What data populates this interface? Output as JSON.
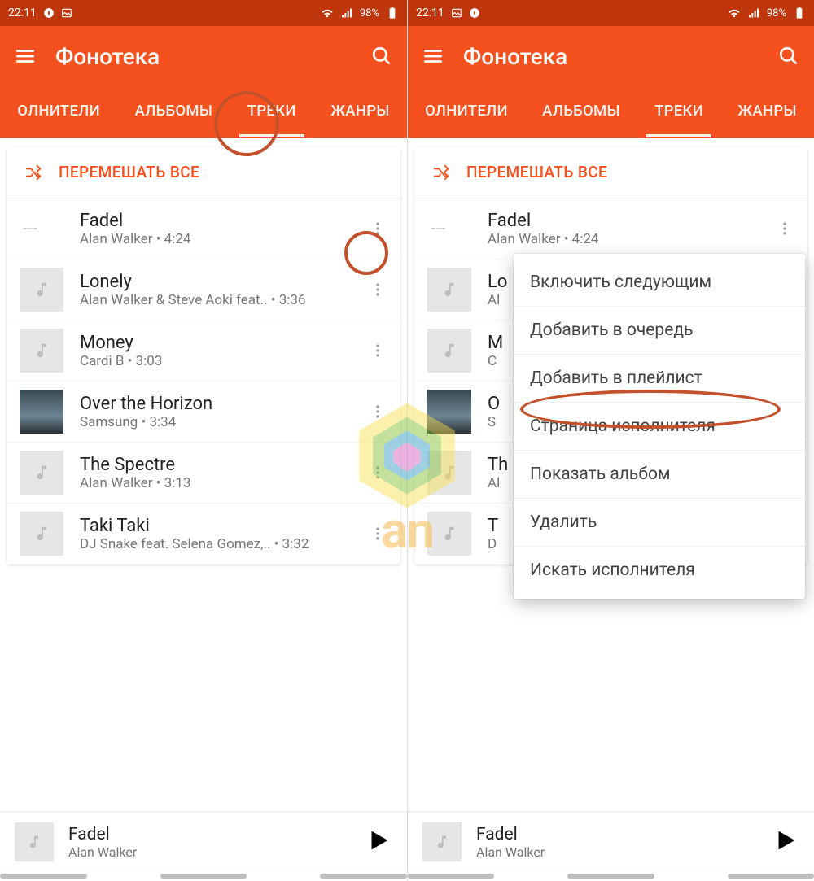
{
  "status": {
    "time": "22:11",
    "battery_pct": "98%"
  },
  "appbar": {
    "title": "Фонотека"
  },
  "tabs": {
    "items": [
      "ОЛНИТЕЛИ",
      "АЛЬБОМЫ",
      "ТРЕКИ",
      "ЖАНРЫ"
    ],
    "active_index": 2
  },
  "shuffle_label": "ПЕРЕМЕШАТЬ ВСЕ",
  "tracks": [
    {
      "title": "Fadel",
      "artist": "Alan Walker",
      "duration": "4:24",
      "art": "dash"
    },
    {
      "title": "Lonely",
      "artist": "Alan Walker & Steve Aoki feat..",
      "duration": "3:36",
      "art": "note"
    },
    {
      "title": "Money",
      "artist": "Cardi B",
      "duration": "3:03",
      "art": "note"
    },
    {
      "title": "Over the Horizon",
      "artist": "Samsung",
      "duration": "3:34",
      "art": "scene"
    },
    {
      "title": "The Spectre",
      "artist": "Alan Walker",
      "duration": "3:13",
      "art": "note"
    },
    {
      "title": "Taki Taki",
      "artist": "DJ Snake feat. Selena Gomez,..",
      "duration": "3:32",
      "art": "note"
    }
  ],
  "tracks_truncated": [
    {
      "title": "Fadel",
      "artist": "Alan Walker",
      "duration": "4:24",
      "art": "dash"
    },
    {
      "title": "Lo",
      "artist": "Al",
      "art": "note"
    },
    {
      "title": "M",
      "artist": "C",
      "art": "note"
    },
    {
      "title": "O",
      "artist": "S",
      "art": "scene"
    },
    {
      "title": "Th",
      "artist": "Al",
      "art": "note"
    },
    {
      "title": "T",
      "artist": "D",
      "art": "note"
    }
  ],
  "context_menu": {
    "items": [
      "Включить следующим",
      "Добавить в очередь",
      "Добавить в плейлист",
      "Страница исполнителя",
      "Показать альбом",
      "Удалить",
      "Искать исполнителя"
    ],
    "highlight_index": 2
  },
  "nowplaying": {
    "title": "Fadel",
    "artist": "Alan Walker"
  },
  "annotations": {
    "left": {
      "tab_circle": true,
      "more_circle_track_index": 0
    },
    "right": {
      "menu_item_ellipse_index": 2
    }
  },
  "watermark_text": "an"
}
